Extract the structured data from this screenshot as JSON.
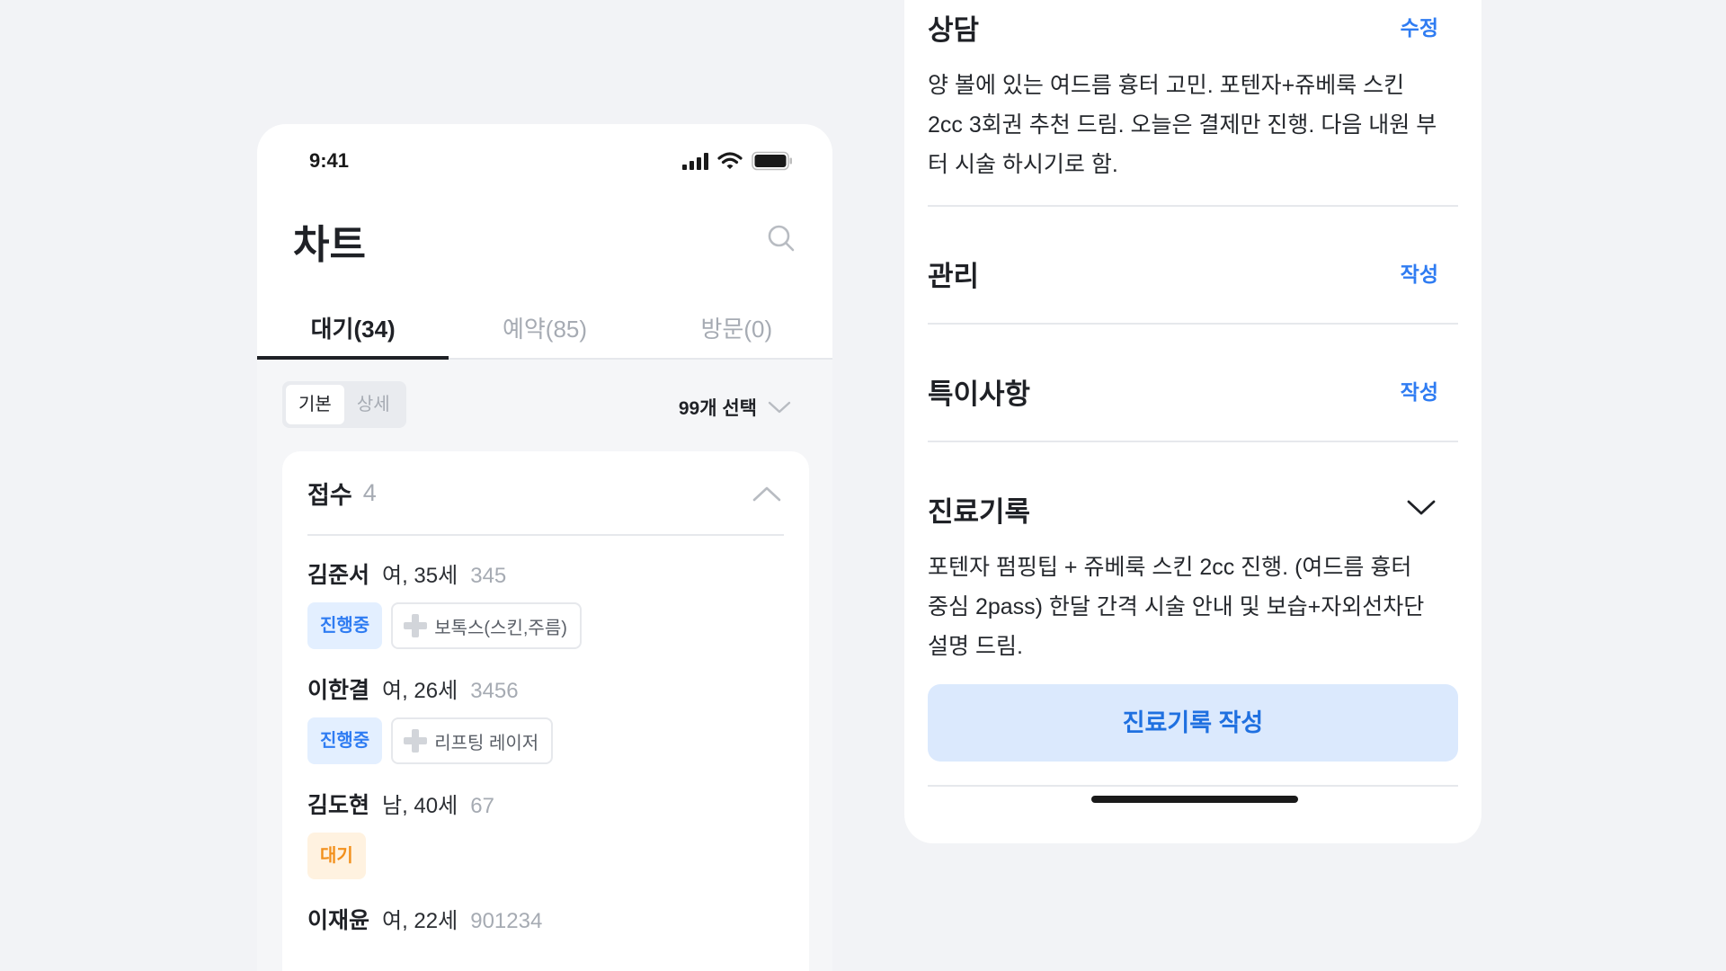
{
  "left_screen": {
    "status_time": "9:41",
    "title": "차트",
    "tabs": [
      {
        "label": "대기(34)",
        "active": true
      },
      {
        "label": "예약(85)",
        "active": false
      },
      {
        "label": "방문(0)",
        "active": false
      }
    ],
    "view_toggle": [
      {
        "label": "기본",
        "active": true
      },
      {
        "label": "상세",
        "active": false
      }
    ],
    "select_label": "99개 선택",
    "section": {
      "title": "접수",
      "count": "4"
    },
    "patients": [
      {
        "name": "김준서",
        "info": "여, 35세",
        "id": "345",
        "status": "진행중",
        "procedure": "보톡스(스킨,주름)"
      },
      {
        "name": "이한결",
        "info": "여, 26세",
        "id": "3456",
        "status": "진행중",
        "procedure": "리프팅 레이저"
      },
      {
        "name": "김도현",
        "info": "남, 40세",
        "id": "67",
        "status": "대기",
        "procedure": ""
      },
      {
        "name": "이재윤",
        "info": "여, 22세",
        "id": "901234",
        "status": "",
        "procedure": ""
      }
    ]
  },
  "right_screen": {
    "consult": {
      "title": "상담",
      "action": "수정",
      "lines": [
        "양 볼에 있는 여드름 흉터 고민. 포텐자+쥬베룩 스킨",
        "2cc 3회권 추천 드림. 오늘은 결제만 진행. 다음 내원 부",
        "터 시술 하시기로 함."
      ]
    },
    "manage": {
      "title": "관리",
      "action": "작성"
    },
    "notes": {
      "title": "특이사항",
      "action": "작성"
    },
    "record": {
      "title": "진료기록",
      "lines": [
        "포텐자 펌핑팁 + 쥬베룩 스킨 2cc 진행. (여드름 흉터",
        "중심 2pass) 한달 간격 시술 안내 및 보습+자외선차단",
        "설명 드림."
      ],
      "button": "진료기록 작성"
    }
  },
  "colors": {
    "accent": "#2f7cf2",
    "progress_badge_bg": "#e3efff",
    "wait_badge_text": "#f2901c",
    "wait_badge_bg": "#fff2e0"
  },
  "icons": [
    "cellular-signal-icon",
    "wifi-icon",
    "battery-icon",
    "search-icon",
    "chevron-down-icon",
    "chevron-up-icon",
    "plus-icon"
  ]
}
